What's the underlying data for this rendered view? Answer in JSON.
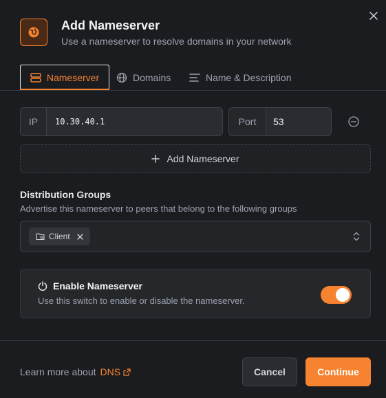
{
  "dialog": {
    "title": "Add Nameserver",
    "subtitle": "Use a nameserver to resolve domains in your network",
    "icon": "globe-icon"
  },
  "tabs": [
    {
      "label": "Nameserver",
      "icon": "server-icon",
      "active": true
    },
    {
      "label": "Domains",
      "icon": "globe-icon",
      "active": false
    },
    {
      "label": "Name & Description",
      "icon": "text-lines-icon",
      "active": false
    }
  ],
  "nameserver": {
    "ip_label": "IP",
    "ip_value": "10.30.40.1",
    "port_label": "Port",
    "port_value": "53",
    "add_label": "Add Nameserver"
  },
  "distribution": {
    "title": "Distribution Groups",
    "description": "Advertise this nameserver to peers that belong to the following groups",
    "groups": [
      {
        "label": "Client"
      }
    ]
  },
  "enable": {
    "title": "Enable Nameserver",
    "description": "Use this switch to enable or disable the nameserver.",
    "enabled": true
  },
  "footer": {
    "learn_more": "Learn more about",
    "link_label": "DNS",
    "cancel_label": "Cancel",
    "continue_label": "Continue"
  },
  "colors": {
    "accent": "#f68330",
    "background": "#1b1c20"
  }
}
